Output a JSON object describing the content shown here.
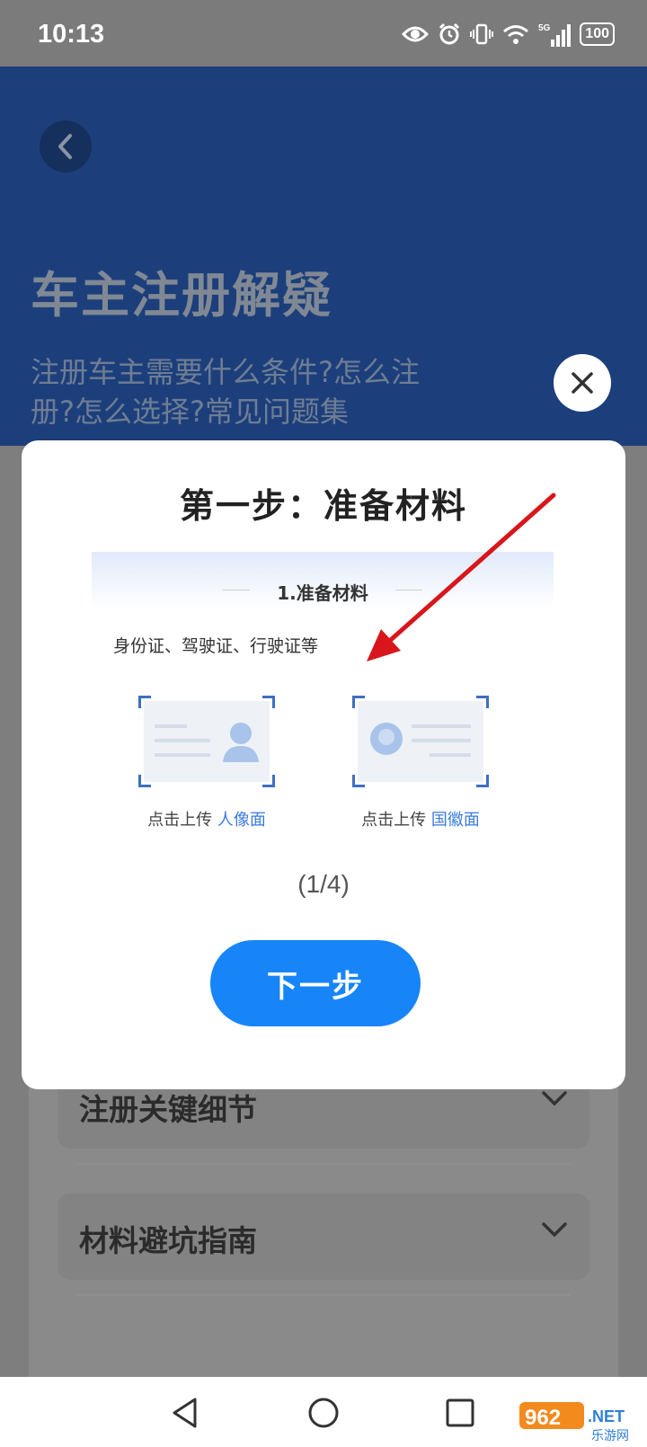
{
  "status_bar": {
    "time": "10:13",
    "signal_label": "5G",
    "battery": "100"
  },
  "header": {
    "title": "车主注册解疑",
    "subtitle": "注册车主需要什么条件?怎么注册?怎么选择?常见问题集"
  },
  "accordion": [
    {
      "label": "注册关键细节"
    },
    {
      "label": "材料避坑指南"
    }
  ],
  "modal": {
    "title": "第一步：准备材料",
    "illustration": {
      "heading": "1.准备材料",
      "description": "身份证、驾驶证、行驶证等",
      "upload_front_prefix": "点击上传",
      "upload_front_highlight": "人像面",
      "upload_back_prefix": "点击上传",
      "upload_back_highlight": "国徽面"
    },
    "pager": "(1/4)",
    "next_label": "下一步"
  },
  "watermark": {
    "brand": "962",
    "suffix": ".NET",
    "caption": "乐游网"
  },
  "colors": {
    "primary_blue": "#1785f7",
    "header_blue": "#1c3f7c",
    "annotation_red": "#d8161b"
  }
}
